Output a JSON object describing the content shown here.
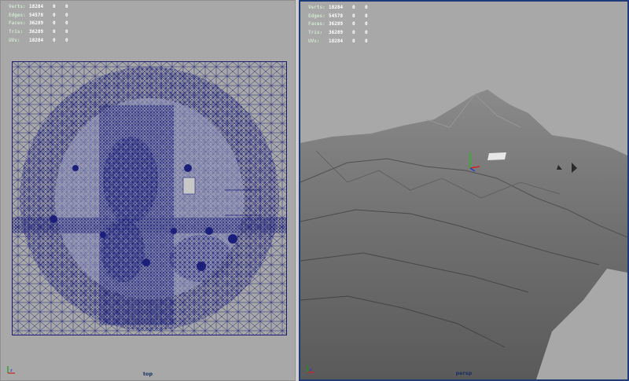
{
  "hud_labels": {
    "verts": "Verts:",
    "edges": "Edges:",
    "faces": "Faces:",
    "tris": "Tris:",
    "uvs": "UVs:"
  },
  "top_view": {
    "stats": {
      "verts": {
        "value": "18284",
        "a": "0",
        "b": "0"
      },
      "edges": {
        "value": "54578",
        "a": "0",
        "b": "0"
      },
      "faces": {
        "value": "36289",
        "a": "0",
        "b": "0"
      },
      "tris": {
        "value": "36289",
        "a": "0",
        "b": "0"
      },
      "uvs": {
        "value": "18284",
        "a": "0",
        "b": "0"
      }
    },
    "camera": "top"
  },
  "persp_view": {
    "stats": {
      "verts": {
        "value": "18284",
        "a": "0",
        "b": "0"
      },
      "edges": {
        "value": "54578",
        "a": "0",
        "b": "0"
      },
      "faces": {
        "value": "36289",
        "a": "0",
        "b": "0"
      },
      "tris": {
        "value": "36289",
        "a": "0",
        "b": "0"
      },
      "uvs": {
        "value": "18284",
        "a": "0",
        "b": "0"
      }
    },
    "camera": "persp"
  },
  "colors": {
    "wire": "#1b1f7a",
    "bg": "#a8a8a8",
    "active_border": "#1e3a78"
  }
}
